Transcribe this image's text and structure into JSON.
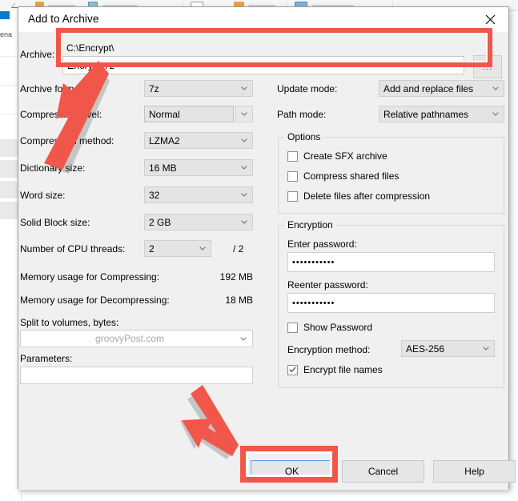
{
  "background": {
    "app": "file-explorer",
    "visible_text": "ena"
  },
  "dialog": {
    "title": "Add to Archive",
    "close_icon": "close-icon",
    "archive": {
      "label": "Archive:",
      "path": "C:\\Encrypt\\",
      "filename": "Encrypt.7z",
      "browse_label": "...",
      "dropdown_icon": "chevron-down-icon"
    },
    "left_fields": [
      {
        "label": "Archive format:",
        "value": "7z",
        "type": "combo"
      },
      {
        "label": "Compression level:",
        "value": "Normal",
        "type": "combo-edit"
      },
      {
        "label": "Compression method:",
        "value": "LZMA2",
        "type": "combo"
      },
      {
        "label": "Dictionary size:",
        "value": "16 MB",
        "type": "combo"
      },
      {
        "label": "Word size:",
        "value": "32",
        "type": "combo"
      },
      {
        "label": "Solid Block size:",
        "value": "2 GB",
        "type": "combo"
      }
    ],
    "cpu_threads": {
      "label": "Number of CPU threads:",
      "value": "2",
      "total": "/ 2"
    },
    "memory": [
      {
        "label": "Memory usage for Compressing:",
        "value": "192 MB"
      },
      {
        "label": "Memory usage for Decompressing:",
        "value": "18 MB"
      }
    ],
    "split": {
      "label": "Split to volumes, bytes:",
      "value": "",
      "placeholder": "groovyPost.com"
    },
    "parameters": {
      "label": "Parameters:",
      "value": ""
    },
    "right_fields": [
      {
        "label": "Update mode:",
        "value": "Add and replace files"
      },
      {
        "label": "Path mode:",
        "value": "Relative pathnames"
      }
    ],
    "options": {
      "title": "Options",
      "items": [
        {
          "label": "Create SFX archive",
          "checked": false
        },
        {
          "label": "Compress shared files",
          "checked": false
        },
        {
          "label": "Delete files after compression",
          "checked": false
        }
      ]
    },
    "encryption": {
      "title": "Encryption",
      "enter_password_label": "Enter password:",
      "enter_password_value": "•••••••••••",
      "reenter_password_label": "Reenter password:",
      "reenter_password_value": "•••••••••••",
      "show_password": {
        "label": "Show Password",
        "checked": false
      },
      "method_label": "Encryption method:",
      "method_value": "AES-256",
      "encrypt_file_names": {
        "label": "Encrypt file names",
        "checked": true
      }
    },
    "buttons": {
      "ok": "OK",
      "cancel": "Cancel",
      "help": "Help"
    }
  },
  "annotations": {
    "highlight_color": "#F0574A",
    "boxes": [
      {
        "name": "archive-field-highlight"
      },
      {
        "name": "ok-button-highlight"
      }
    ],
    "arrows": [
      {
        "name": "arrow-to-archive-field",
        "direction": "up-right"
      },
      {
        "name": "arrow-to-ok-button",
        "direction": "down-right"
      }
    ]
  }
}
